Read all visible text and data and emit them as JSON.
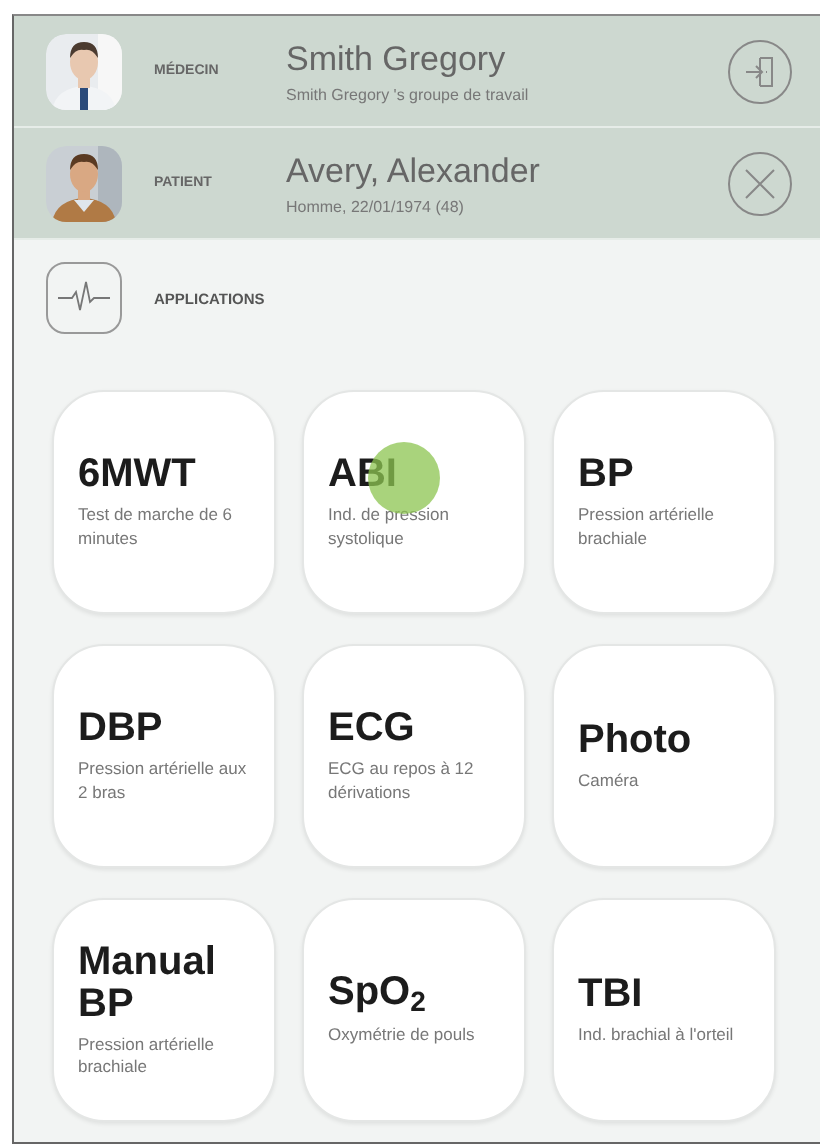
{
  "header": [
    {
      "kind": "doctor",
      "role": "MÉDECIN",
      "name": "Smith Gregory",
      "detail": "Smith Gregory 's groupe de travail"
    },
    {
      "kind": "patient",
      "role": "PATIENT",
      "name": "Avery, Alexander",
      "detail": "Homme, 22/01/1974 (48)"
    }
  ],
  "section": {
    "title": "APPLICATIONS"
  },
  "apps": [
    {
      "title": "6MWT",
      "subtitle": "Test de marche de 6 minutes",
      "touched": false
    },
    {
      "title": "ABI",
      "subtitle": "Ind. de pression systolique",
      "touched": true
    },
    {
      "title": "BP",
      "subtitle": "Pression artérielle brachiale",
      "touched": false
    },
    {
      "title": "DBP",
      "subtitle": "Pression artérielle aux 2 bras",
      "touched": false
    },
    {
      "title": "ECG",
      "subtitle": "ECG au repos à 12 dérivations",
      "touched": false
    },
    {
      "title": "Photo",
      "subtitle": "Caméra",
      "touched": false
    },
    {
      "title": "Manual BP",
      "subtitle": "Pression artérielle brachiale",
      "touched": false
    },
    {
      "title": "SpO$_{2}$",
      "subtitle": "Oxymétrie de pouls",
      "touched": false
    },
    {
      "title": "TBI",
      "subtitle": "Ind. brachial à l'orteil",
      "touched": false
    }
  ]
}
